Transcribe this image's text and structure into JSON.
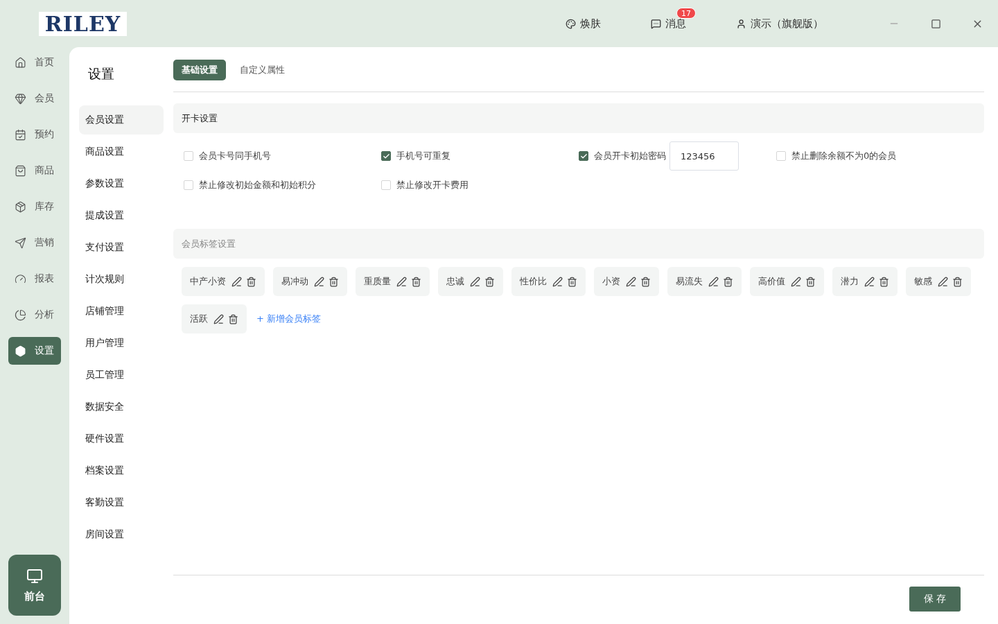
{
  "logo": "RILEY",
  "header": {
    "actions": [
      {
        "kind": "skin",
        "label": "焕肤"
      },
      {
        "kind": "messages",
        "label": "消息",
        "badge": "17"
      },
      {
        "kind": "user",
        "label": "演示（旗舰版）"
      }
    ]
  },
  "nav": {
    "items": [
      {
        "kind": "home",
        "label": "首页",
        "selected": false
      },
      {
        "kind": "member",
        "label": "会员",
        "selected": false
      },
      {
        "kind": "booking",
        "label": "预约",
        "selected": false
      },
      {
        "kind": "goods",
        "label": "商品",
        "selected": false
      },
      {
        "kind": "stock",
        "label": "库存",
        "selected": false
      },
      {
        "kind": "marketing",
        "label": "营销",
        "selected": false
      },
      {
        "kind": "report",
        "label": "报表",
        "selected": false
      },
      {
        "kind": "analysis",
        "label": "分析",
        "selected": false
      },
      {
        "kind": "settings",
        "label": "设置",
        "selected": true
      }
    ],
    "front_desk": "前台"
  },
  "settings_menu": {
    "title": "设置",
    "items": [
      {
        "label": "会员设置",
        "selected": true
      },
      {
        "label": "商品设置",
        "selected": false
      },
      {
        "label": "参数设置",
        "selected": false
      },
      {
        "label": "提成设置",
        "selected": false
      },
      {
        "label": "支付设置",
        "selected": false
      },
      {
        "label": "计次规则",
        "selected": false
      },
      {
        "label": "店铺管理",
        "selected": false
      },
      {
        "label": "用户管理",
        "selected": false
      },
      {
        "label": "员工管理",
        "selected": false
      },
      {
        "label": "数据安全",
        "selected": false
      },
      {
        "label": "硬件设置",
        "selected": false
      },
      {
        "label": "档案设置",
        "selected": false
      },
      {
        "label": "客勤设置",
        "selected": false
      },
      {
        "label": "房间设置",
        "selected": false
      }
    ]
  },
  "tabs": [
    {
      "label": "基础设置",
      "selected": true
    },
    {
      "label": "自定义属性",
      "selected": false
    }
  ],
  "card_section": {
    "title": "开卡设置",
    "options": [
      {
        "kind": "checkbox",
        "label": "会员卡号同手机号",
        "checked": false
      },
      {
        "kind": "checkbox",
        "label": "手机号可重复",
        "checked": true
      },
      {
        "kind": "checkbox-input",
        "label": "会员开卡初始密码",
        "checked": true,
        "value": "123456"
      },
      {
        "kind": "checkbox",
        "label": "禁止删除余额不为0的会员",
        "checked": false
      },
      {
        "kind": "checkbox",
        "label": "禁止修改初始金额和初始积分",
        "checked": false
      },
      {
        "kind": "checkbox",
        "label": "禁止修改开卡费用",
        "checked": false
      }
    ]
  },
  "tag_section": {
    "title": "会员标签设置",
    "tags": [
      "中产小资",
      "易冲动",
      "重质量",
      "忠诚",
      "性价比",
      "小资",
      "易流失",
      "高价值",
      "潜力",
      "敏感",
      "活跃"
    ],
    "add_label": "+ 新增会员标签"
  },
  "save_button": "保 存"
}
